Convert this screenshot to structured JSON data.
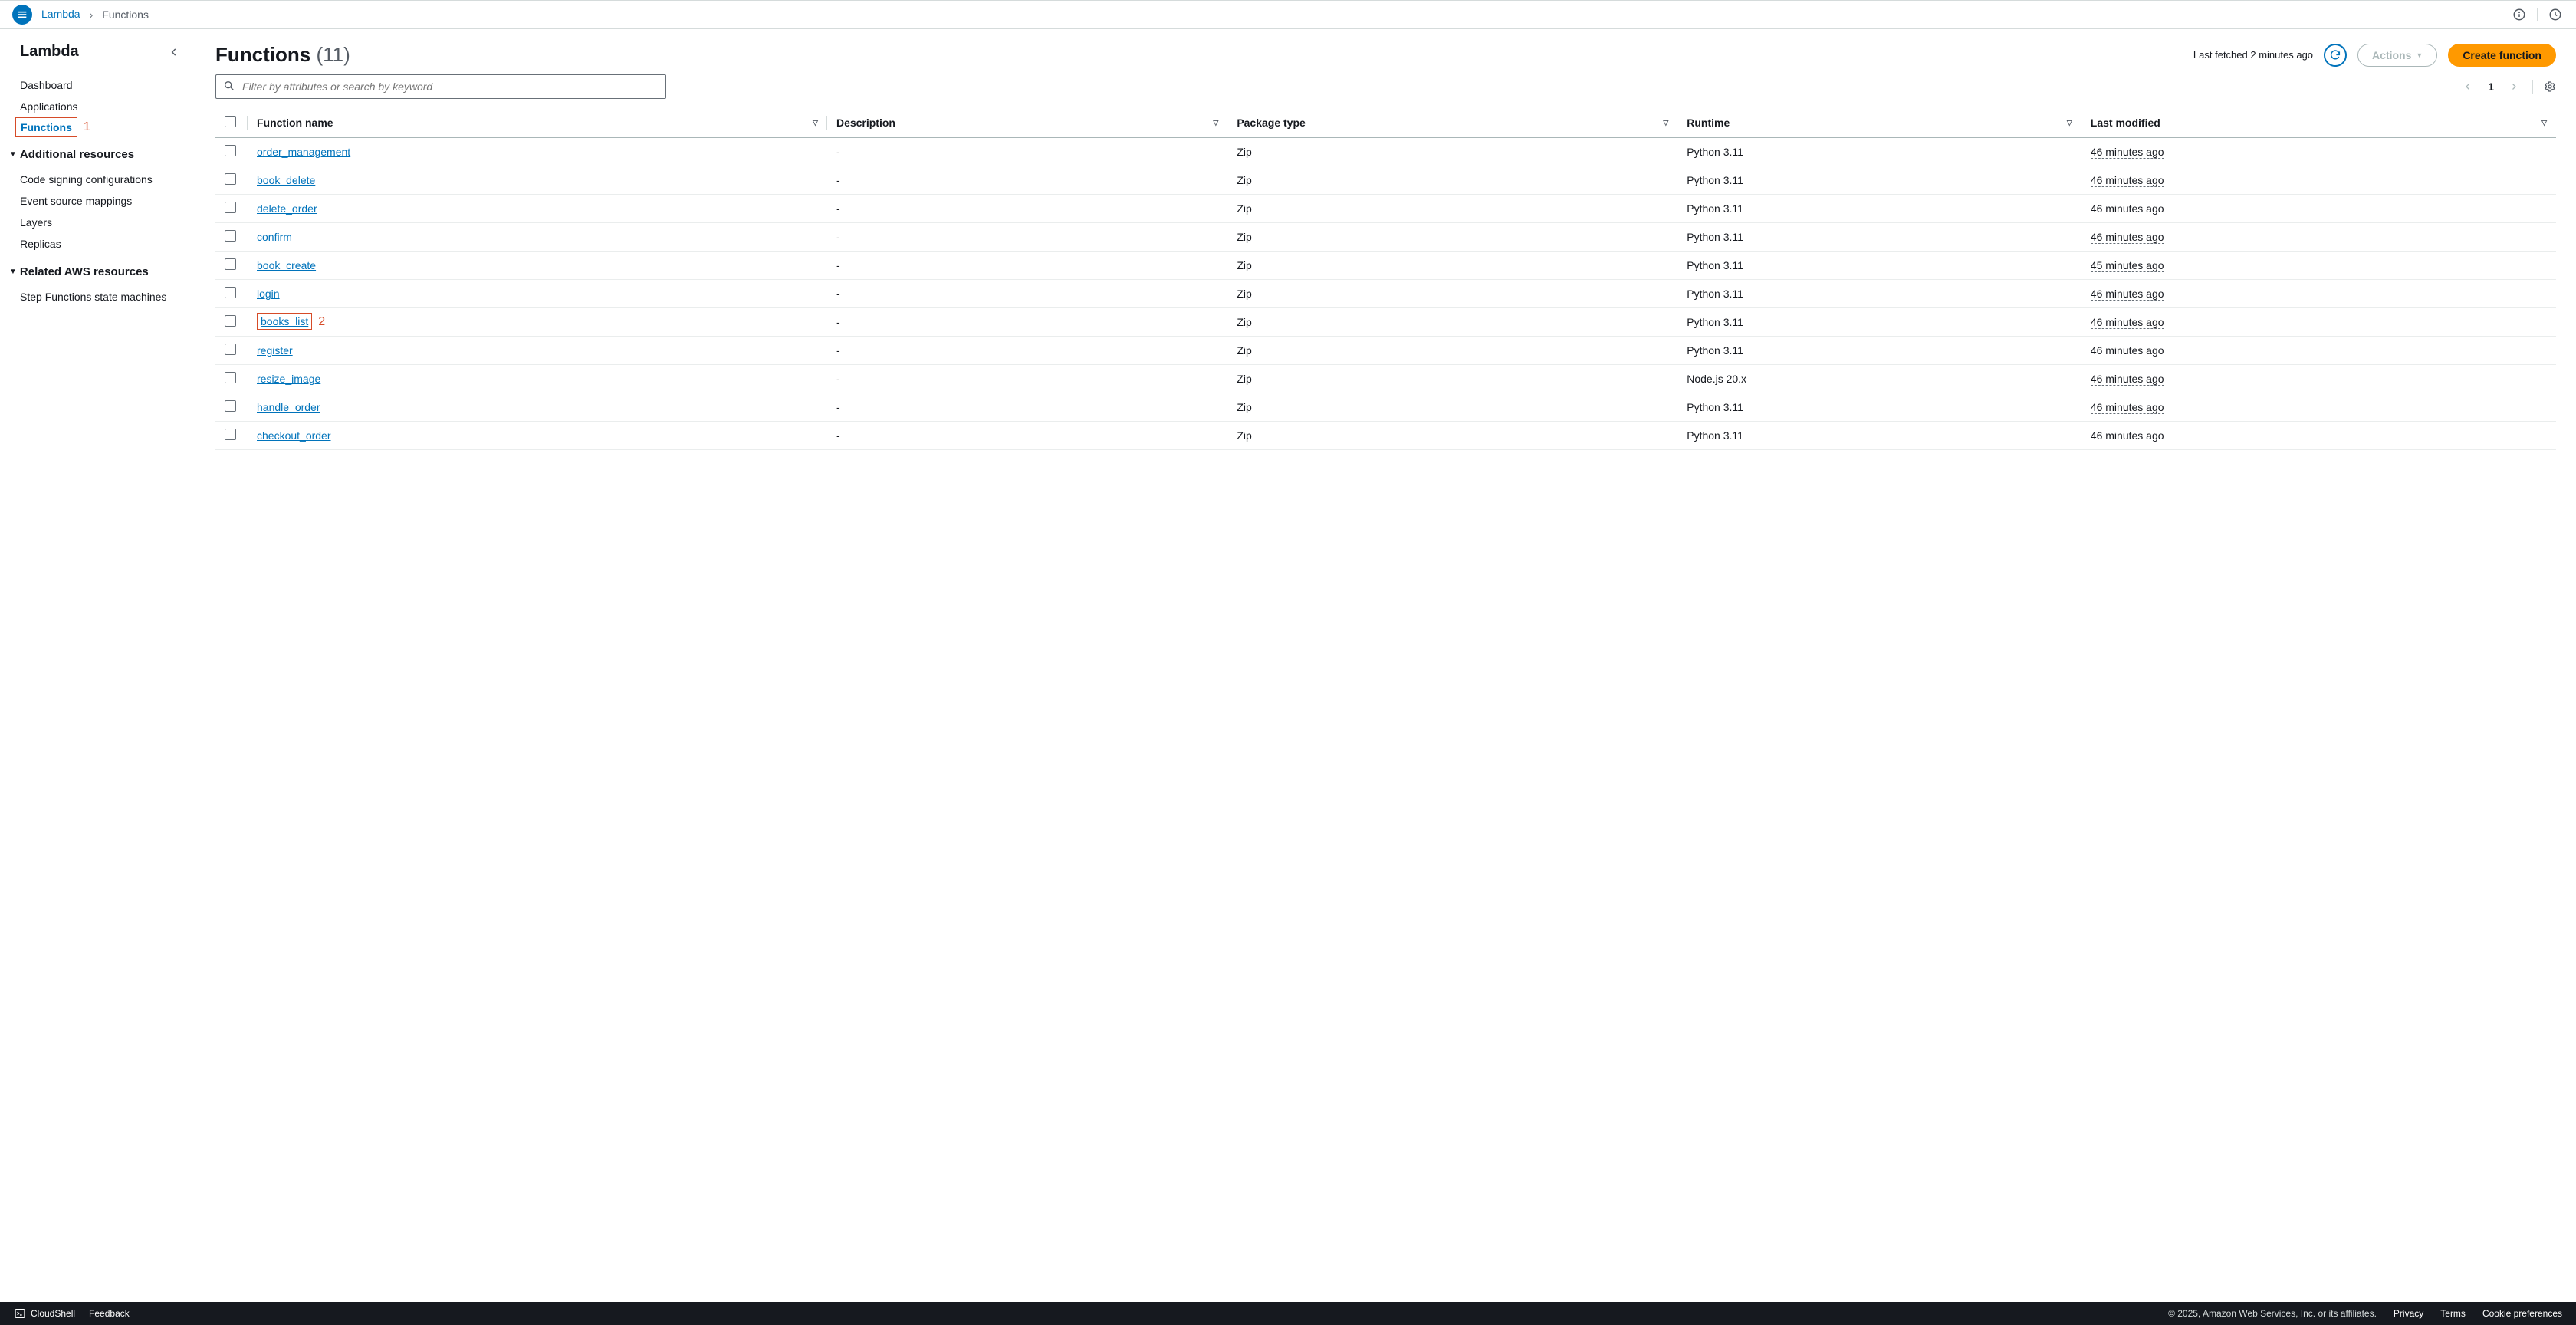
{
  "breadcrumb": {
    "root": "Lambda",
    "current": "Functions"
  },
  "topbar_icons": {
    "info": "info-icon",
    "notifications": "notifications-icon"
  },
  "sidebar": {
    "title": "Lambda",
    "items": [
      {
        "label": "Dashboard"
      },
      {
        "label": "Applications"
      },
      {
        "label": "Functions",
        "active": true,
        "annotation": "1"
      }
    ],
    "sections": [
      {
        "title": "Additional resources",
        "items": [
          {
            "label": "Code signing configurations"
          },
          {
            "label": "Event source mappings"
          },
          {
            "label": "Layers"
          },
          {
            "label": "Replicas"
          }
        ]
      },
      {
        "title": "Related AWS resources",
        "items": [
          {
            "label": "Step Functions state machines"
          }
        ]
      }
    ]
  },
  "page": {
    "title": "Functions",
    "count_label": "(11)",
    "last_fetched_prefix": "Last fetched",
    "last_fetched_ago": "2 minutes ago",
    "actions_label": "Actions",
    "create_label": "Create function",
    "search_placeholder": "Filter by attributes or search by keyword",
    "page_number": "1"
  },
  "table": {
    "columns": [
      "Function name",
      "Description",
      "Package type",
      "Runtime",
      "Last modified"
    ],
    "rows": [
      {
        "name": "order_management",
        "description": "-",
        "package": "Zip",
        "runtime": "Python 3.11",
        "modified": "46 minutes ago"
      },
      {
        "name": "book_delete",
        "description": "-",
        "package": "Zip",
        "runtime": "Python 3.11",
        "modified": "46 minutes ago"
      },
      {
        "name": "delete_order",
        "description": "-",
        "package": "Zip",
        "runtime": "Python 3.11",
        "modified": "46 minutes ago"
      },
      {
        "name": "confirm",
        "description": "-",
        "package": "Zip",
        "runtime": "Python 3.11",
        "modified": "46 minutes ago"
      },
      {
        "name": "book_create",
        "description": "-",
        "package": "Zip",
        "runtime": "Python 3.11",
        "modified": "45 minutes ago"
      },
      {
        "name": "login",
        "description": "-",
        "package": "Zip",
        "runtime": "Python 3.11",
        "modified": "46 minutes ago"
      },
      {
        "name": "books_list",
        "description": "-",
        "package": "Zip",
        "runtime": "Python 3.11",
        "modified": "46 minutes ago",
        "annotation": "2"
      },
      {
        "name": "register",
        "description": "-",
        "package": "Zip",
        "runtime": "Python 3.11",
        "modified": "46 minutes ago"
      },
      {
        "name": "resize_image",
        "description": "-",
        "package": "Zip",
        "runtime": "Node.js 20.x",
        "modified": "46 minutes ago"
      },
      {
        "name": "handle_order",
        "description": "-",
        "package": "Zip",
        "runtime": "Python 3.11",
        "modified": "46 minutes ago"
      },
      {
        "name": "checkout_order",
        "description": "-",
        "package": "Zip",
        "runtime": "Python 3.11",
        "modified": "46 minutes ago"
      }
    ]
  },
  "footer": {
    "cloudshell": "CloudShell",
    "feedback": "Feedback",
    "copyright": "© 2025, Amazon Web Services, Inc. or its affiliates.",
    "links": [
      "Privacy",
      "Terms",
      "Cookie preferences"
    ]
  }
}
